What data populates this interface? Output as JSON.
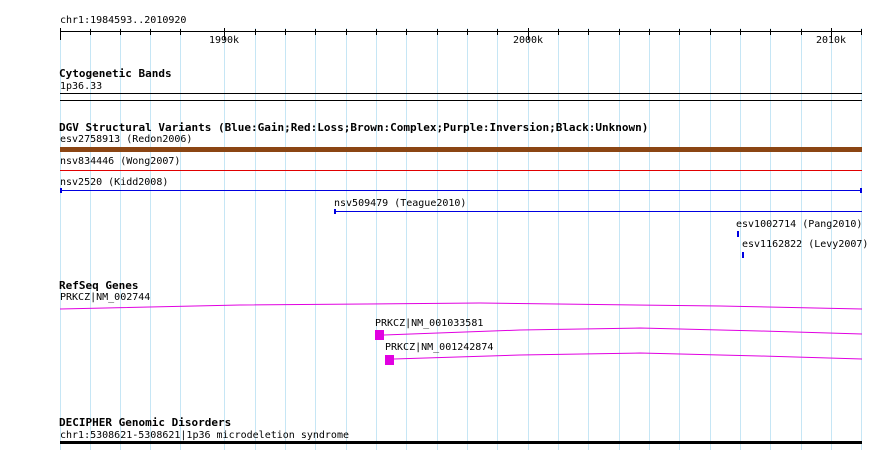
{
  "ruler": {
    "coordinates": "chr1:1984593..2010920",
    "ticks": [
      "1990k",
      "2000k",
      "2010k"
    ]
  },
  "colors": {
    "grid": "#c6e6f5",
    "dgv_brown": "#8b4513",
    "dgv_red": "#e00000",
    "dgv_blue": "#0000e0",
    "refseq_magenta": "#e100e1"
  },
  "tracks": {
    "cytoband": {
      "title": "Cytogenetic Bands",
      "band": "1p36.33"
    },
    "dgv": {
      "title": "DGV Structural Variants (Blue:Gain;Red:Loss;Brown:Complex;Purple:Inversion;Black:Unknown)",
      "features": [
        {
          "label": "esv2758913 (Redon2006)",
          "type": "Complex"
        },
        {
          "label": "nsv834446 (Wong2007)",
          "type": "Loss"
        },
        {
          "label": "nsv2520 (Kidd2008)",
          "type": "Gain"
        },
        {
          "label": "nsv509479 (Teague2010)",
          "type": "Gain"
        },
        {
          "label": "esv1002714 (Pang2010)",
          "type": "Gain"
        },
        {
          "label": "esv1162822 (Levy2007)",
          "type": "Gain"
        }
      ]
    },
    "refseq": {
      "title": "RefSeq Genes",
      "genes": [
        {
          "label": "PRKCZ|NM_002744"
        },
        {
          "label": "PRKCZ|NM_001033581"
        },
        {
          "label": "PRKCZ|NM_001242874"
        }
      ]
    },
    "decipher": {
      "title": "DECIPHER Genomic Disorders",
      "feature": "chr1:5308621-5308621|1p36 microdeletion syndrome"
    }
  }
}
